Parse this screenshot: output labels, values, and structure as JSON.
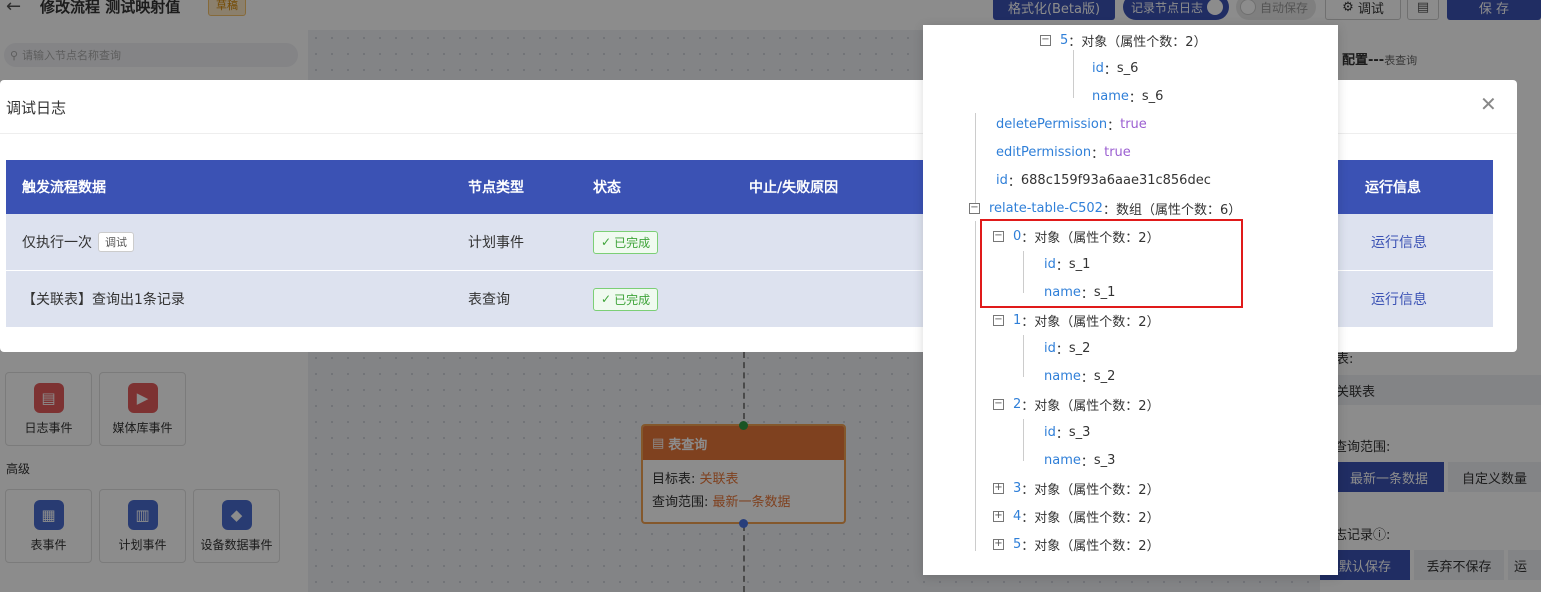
{
  "topbar": {
    "title": "修改流程 测试映射值",
    "draft_badge": "草稿",
    "format_button": "格式化(Beta版)",
    "log_toggle": "记录节点日志",
    "autosave_toggle": "自动保存",
    "debug_button": "调试",
    "save_button": "保 存"
  },
  "sidebar": {
    "search_placeholder": "请输入节点名称查询",
    "events_row1": [
      {
        "label": "日志事件",
        "icon": "clipboard-icon",
        "color": "#e45c5c"
      },
      {
        "label": "媒体库事件",
        "icon": "media-icon",
        "color": "#e45c5c"
      }
    ],
    "advanced_title": "高级",
    "events_row2": [
      {
        "label": "表事件",
        "icon": "table-event-icon",
        "color": "#4a6ccf"
      },
      {
        "label": "计划事件",
        "icon": "schedule-icon",
        "color": "#4a6ccf"
      },
      {
        "label": "设备数据事件",
        "icon": "cube-icon",
        "color": "#4a6ccf"
      }
    ]
  },
  "node": {
    "title": "表查询",
    "target_label": "目标表: ",
    "target_value": "关联表",
    "range_label": "查询范围: ",
    "range_value": "最新一条数据"
  },
  "right_panel": {
    "title": "配置---",
    "subtitle": "表查询",
    "table_label": "表:",
    "table_value": "关联表",
    "range_label": "查询范围:",
    "range_options": [
      "最新一条数据",
      "自定义数量"
    ],
    "log_label": "志记录",
    "log_options": [
      "默认保存",
      "丢弃不保存",
      "运"
    ]
  },
  "modal": {
    "title": "调试日志",
    "columns": [
      "触发流程数据",
      "节点类型",
      "状态",
      "中止/失败原因",
      "运行信息"
    ],
    "rows": [
      {
        "data": "仅执行一次",
        "tag": "调试",
        "type": "计划事件",
        "status": "已完成",
        "reason": "",
        "info": "运行信息"
      },
      {
        "data": "【关联表】查询出1条记录",
        "tag": "",
        "type": "表查询",
        "status": "已完成",
        "reason": "",
        "info": "运行信息"
      }
    ]
  },
  "tree": {
    "lines": [
      {
        "key": "5",
        "sep": "：",
        "val": "对象（属性个数：2）",
        "type": "node",
        "toggle": "-"
      },
      {
        "key": "id",
        "sep": "：",
        "val": "s_6",
        "type": "leaf"
      },
      {
        "key": "name",
        "sep": "：",
        "val": "s_6",
        "type": "leaf"
      },
      {
        "key": "deletePermission",
        "sep": "：",
        "val": "true",
        "type": "bool"
      },
      {
        "key": "editPermission",
        "sep": "：",
        "val": "true",
        "type": "bool"
      },
      {
        "key": "id",
        "sep": "：",
        "val": "688c159f93a6aae31c856dec",
        "type": "leaf"
      },
      {
        "key": "relate-table-C502",
        "sep": "：",
        "val": "数组（属性个数：6）",
        "type": "node",
        "toggle": "-"
      },
      {
        "key": "0",
        "sep": "：",
        "val": "对象（属性个数：2）",
        "type": "node",
        "toggle": "-"
      },
      {
        "key": "id",
        "sep": "：",
        "val": "s_1",
        "type": "leaf"
      },
      {
        "key": "name",
        "sep": "：",
        "val": "s_1",
        "type": "leaf"
      },
      {
        "key": "1",
        "sep": "：",
        "val": "对象（属性个数：2）",
        "type": "node",
        "toggle": "-"
      },
      {
        "key": "id",
        "sep": "：",
        "val": "s_2",
        "type": "leaf"
      },
      {
        "key": "name",
        "sep": "：",
        "val": "s_2",
        "type": "leaf"
      },
      {
        "key": "2",
        "sep": "：",
        "val": "对象（属性个数：2）",
        "type": "node",
        "toggle": "-"
      },
      {
        "key": "id",
        "sep": "：",
        "val": "s_3",
        "type": "leaf"
      },
      {
        "key": "name",
        "sep": "：",
        "val": "s_3",
        "type": "leaf"
      },
      {
        "key": "3",
        "sep": "：",
        "val": "对象（属性个数：2）",
        "type": "node",
        "toggle": "+"
      },
      {
        "key": "4",
        "sep": "：",
        "val": "对象（属性个数：2）",
        "type": "node",
        "toggle": "+"
      },
      {
        "key": "5",
        "sep": "：",
        "val": "对象（属性个数：2）",
        "type": "node",
        "toggle": "+"
      }
    ]
  }
}
